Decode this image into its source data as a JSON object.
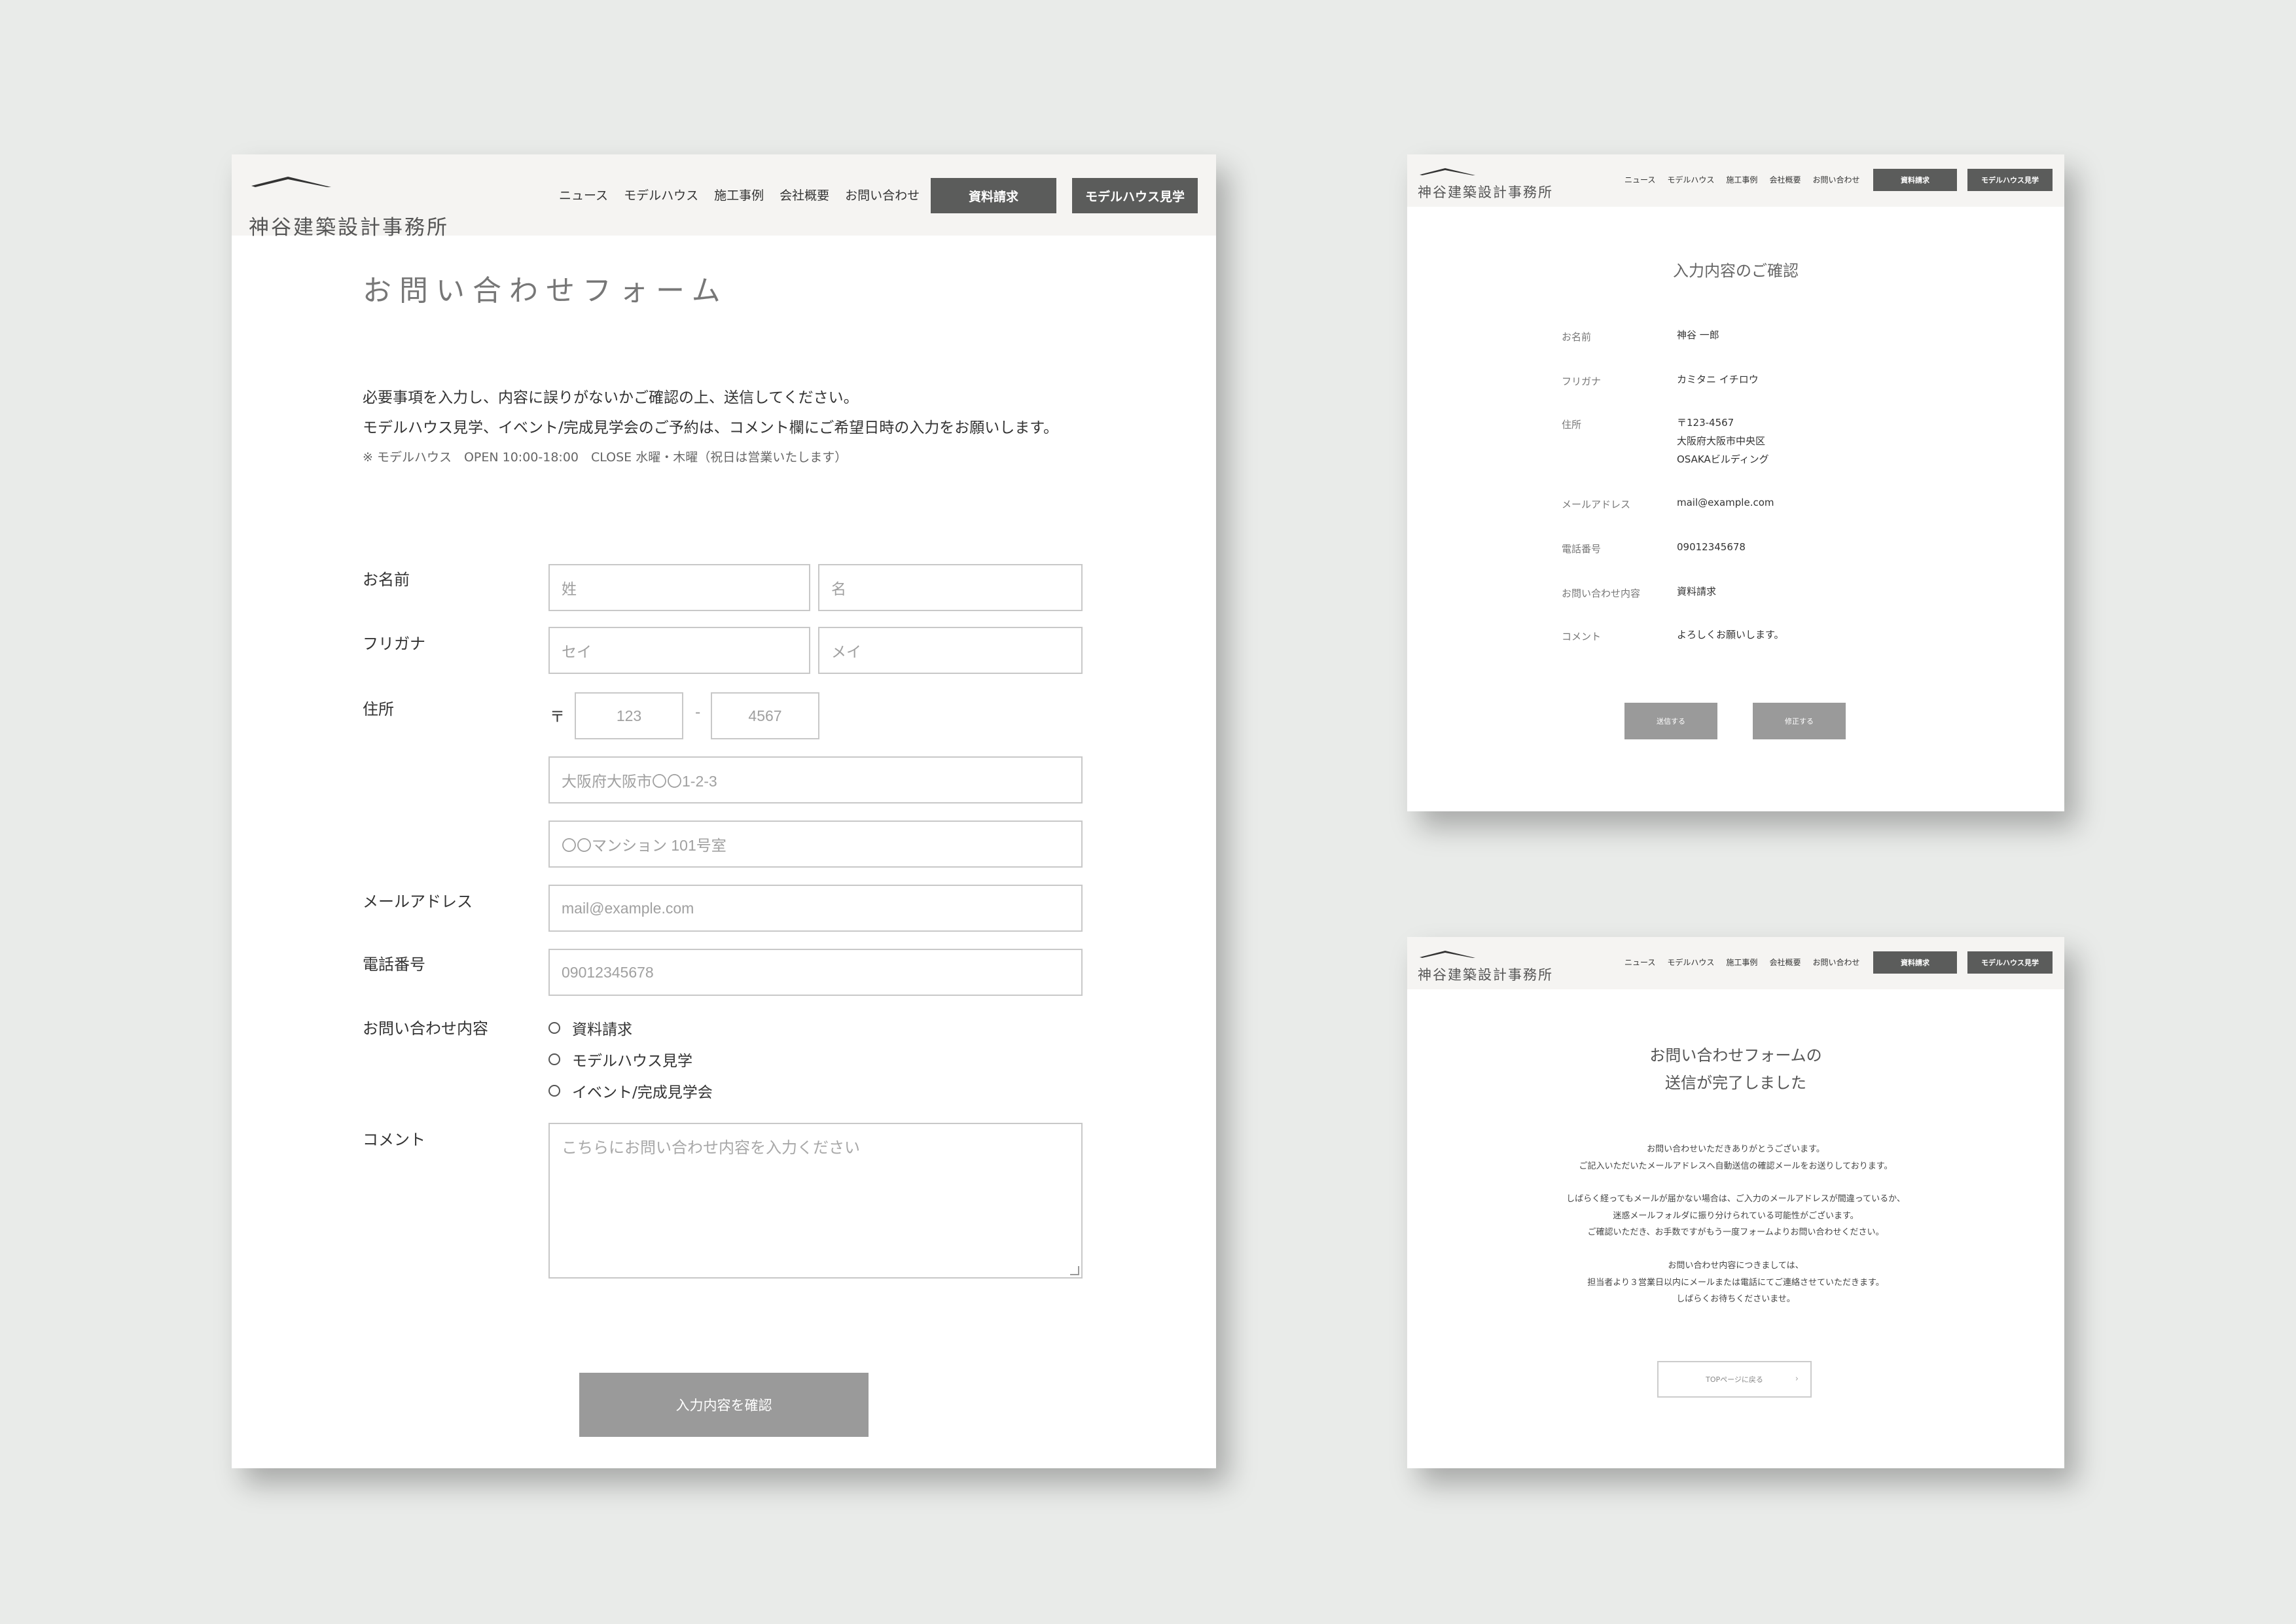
{
  "brand": "神谷建築設計事務所",
  "nav": [
    "ニュース",
    "モデルハウス",
    "施工事例",
    "会社概要",
    "お問い合わせ"
  ],
  "header_buttons": {
    "request": "資料請求",
    "visit": "モデルハウス見学"
  },
  "form": {
    "title": "お問い合わせフォーム",
    "intro1": "必要事項を入力し、内容に誤りがないかご確認の上、送信してください。",
    "intro2": "モデルハウス見学、イベント/完成見学会のご予約は、コメント欄にご希望日時の入力をお願いします。",
    "note": "※ モデルハウス　OPEN 10:00-18:00　CLOSE 水曜・木曜（祝日は営業いたします）",
    "labels": {
      "name": "お名前",
      "kana": "フリガナ",
      "address": "住所",
      "email": "メールアドレス",
      "phone": "電話番号",
      "inquiry": "お問い合わせ内容",
      "comment": "コメント"
    },
    "placeholders": {
      "last_name": "姓",
      "first_name": "名",
      "last_kana": "セイ",
      "first_kana": "メイ",
      "postal_symbol": "〒",
      "postal_dash": "-",
      "postal1": "123",
      "postal2": "4567",
      "address1": "大阪府大阪市〇〇1-2-3",
      "address2": "〇〇マンション 101号室",
      "email": "mail@example.com",
      "phone": "09012345678",
      "comment": "こちらにお問い合わせ内容を入力ください"
    },
    "inquiry_options": [
      "資料請求",
      "モデルハウス見学",
      "イベント/完成見学会"
    ],
    "submit": "入力内容を確認"
  },
  "confirm": {
    "title": "入力内容のご確認",
    "rows": [
      {
        "label": "お名前",
        "value": "神谷 一郎"
      },
      {
        "label": "フリガナ",
        "value": "カミタニ イチロウ"
      },
      {
        "label": "住所",
        "lines": [
          "〒123-4567",
          "大阪府大阪市中央区",
          "OSAKAビルディング"
        ]
      },
      {
        "label": "メールアドレス",
        "value": "mail@example.com"
      },
      {
        "label": "電話番号",
        "value": "09012345678"
      },
      {
        "label": "お問い合わせ内容",
        "value": "資料請求"
      },
      {
        "label": "コメント",
        "value": "よろしくお願いします。"
      }
    ],
    "send": "送信する",
    "edit": "修正する"
  },
  "complete": {
    "title1": "お問い合わせフォームの",
    "title2": "送信が完了しました",
    "p1": [
      "お問い合わせいただきありがとうございます。",
      "ご記入いただいたメールアドレスへ自動送信の確認メールをお送りしております。"
    ],
    "p2": [
      "しばらく経ってもメールが届かない場合は、ご入力のメールアドレスが間違っているか、",
      "迷惑メールフォルダに振り分けられている可能性がございます。",
      "ご確認いただき、お手数ですがもう一度フォームよりお問い合わせください。"
    ],
    "p3": [
      "お問い合わせ内容につきましては、",
      "担当者より３営業日以内にメールまたは電話にてご連絡させていただきます。",
      "しばらくお待ちくださいませ。"
    ],
    "top_button": "TOPページに戻る"
  }
}
